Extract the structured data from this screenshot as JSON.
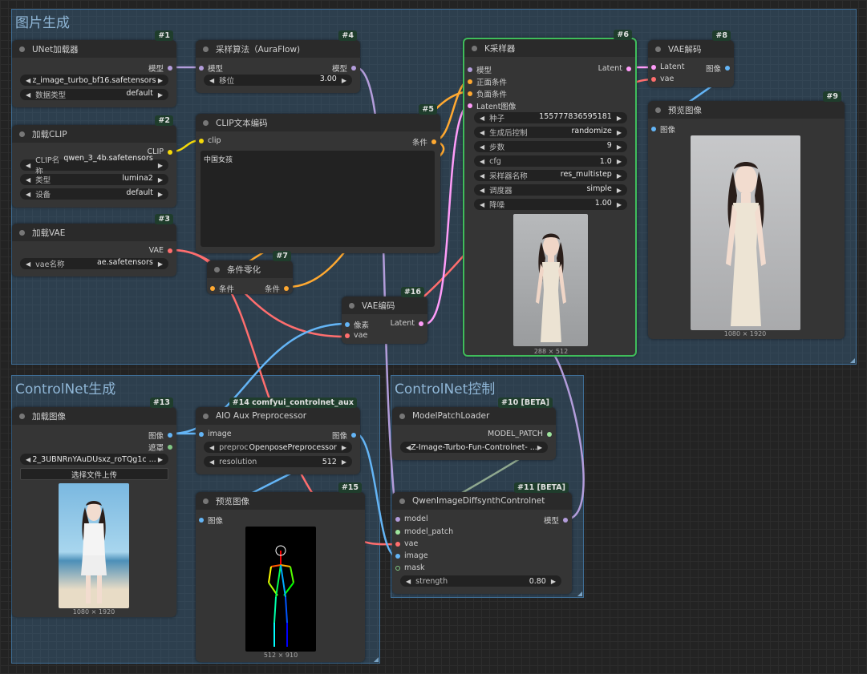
{
  "groups": {
    "image_gen": "图片生成",
    "controlnet_gen": "ControlNet生成",
    "controlnet_ctrl": "ControlNet控制"
  },
  "nodes": {
    "n1": {
      "badge": "#1",
      "title": "UNet加载器",
      "out_model": "模型",
      "unet_name": "z_image_turbo_bf16.safetensors",
      "dtype_label": "数据类型",
      "dtype": "default"
    },
    "n2": {
      "badge": "#2",
      "title": "加载CLIP",
      "out_clip": "CLIP",
      "clip_name_label": "CLIP名称",
      "clip_name": "qwen_3_4b.safetensors",
      "type_label": "类型",
      "type": "lumina2",
      "device_label": "设备",
      "device": "default"
    },
    "n3": {
      "badge": "#3",
      "title": "加载VAE",
      "out_vae": "VAE",
      "vae_name_label": "vae名称",
      "vae_name": "ae.safetensors"
    },
    "n4": {
      "badge": "#4",
      "title": "采样算法（AuraFlow)",
      "in_model": "模型",
      "out_model": "模型",
      "shift_label": "移位",
      "shift": "3.00"
    },
    "n5": {
      "badge": "#5",
      "title": "CLIP文本编码",
      "in_clip": "clip",
      "out_cond": "条件",
      "text": "中国女孩"
    },
    "n7": {
      "badge": "#7",
      "title": "条件零化",
      "in_cond": "条件",
      "out_cond": "条件"
    },
    "n6": {
      "badge": "#6",
      "title": "K采样器",
      "in_model": "模型",
      "in_pos": "正面条件",
      "in_neg": "负面条件",
      "in_latent": "Latent图像",
      "out_latent": "Latent",
      "seed_label": "种子",
      "seed": "155777836595181",
      "ctrl_label": "生成后控制",
      "ctrl": "randomize",
      "steps_label": "步数",
      "steps": "9",
      "cfg_label": "cfg",
      "cfg": "1.0",
      "sampler_label": "采样器名称",
      "sampler": "res_multistep",
      "sched_label": "调度器",
      "sched": "simple",
      "denoise_label": "降噪",
      "denoise": "1.00",
      "preview_size": "288 × 512"
    },
    "n8": {
      "badge": "#8",
      "title": "VAE解码",
      "in_latent": "Latent",
      "in_vae": "vae",
      "out_image": "图像"
    },
    "n9": {
      "badge": "#9",
      "title": "预览图像",
      "in_image": "图像",
      "preview_size": "1080 × 1920"
    },
    "n16": {
      "badge": "#16",
      "title": "VAE编码",
      "in_pixels": "像素",
      "in_vae": "vae",
      "out_latent": "Latent"
    },
    "n13": {
      "badge": "#13",
      "title": "加载图像",
      "out_image": "图像",
      "out_mask": "遮罩",
      "file": "2_3UBNRnYAuDUsxz_roTQg1c ...",
      "upload": "选择文件上传",
      "preview_size": "1080 × 1920"
    },
    "n14": {
      "badge": "#14 comfyui_controlnet_aux",
      "title": "AIO Aux Preprocessor",
      "in_image": "image",
      "out_image": "图像",
      "preproc_label": "preproc",
      "preproc": "OpenposePreprocessor",
      "res_label": "resolution",
      "res": "512"
    },
    "n15": {
      "badge": "#15",
      "title": "预览图像",
      "in_image": "图像",
      "preview_size": "512 × 910"
    },
    "n10": {
      "badge": "#10 [BETA]",
      "title": "ModelPatchLoader",
      "out_patch": "MODEL_PATCH",
      "patch_name": "Z-Image-Turbo-Fun-Controlnet- ..."
    },
    "n11": {
      "badge": "#11 [BETA]",
      "title": "QwenImageDiffsynthControlnet",
      "in_model": "model",
      "in_patch": "model_patch",
      "in_vae": "vae",
      "in_image": "image",
      "in_mask": "mask",
      "out_model": "模型",
      "strength_label": "strength",
      "strength": "0.80"
    }
  },
  "colors": {
    "model": "#b39ddb",
    "clip": "#f5d90a",
    "vae": "#ff6e6e",
    "cond": "#ffa931",
    "latent": "#ff9cf9",
    "image": "#64b5f6",
    "mask": "#81c784",
    "patch": "#9ee59e",
    "border_active": "#3fbd5b"
  }
}
